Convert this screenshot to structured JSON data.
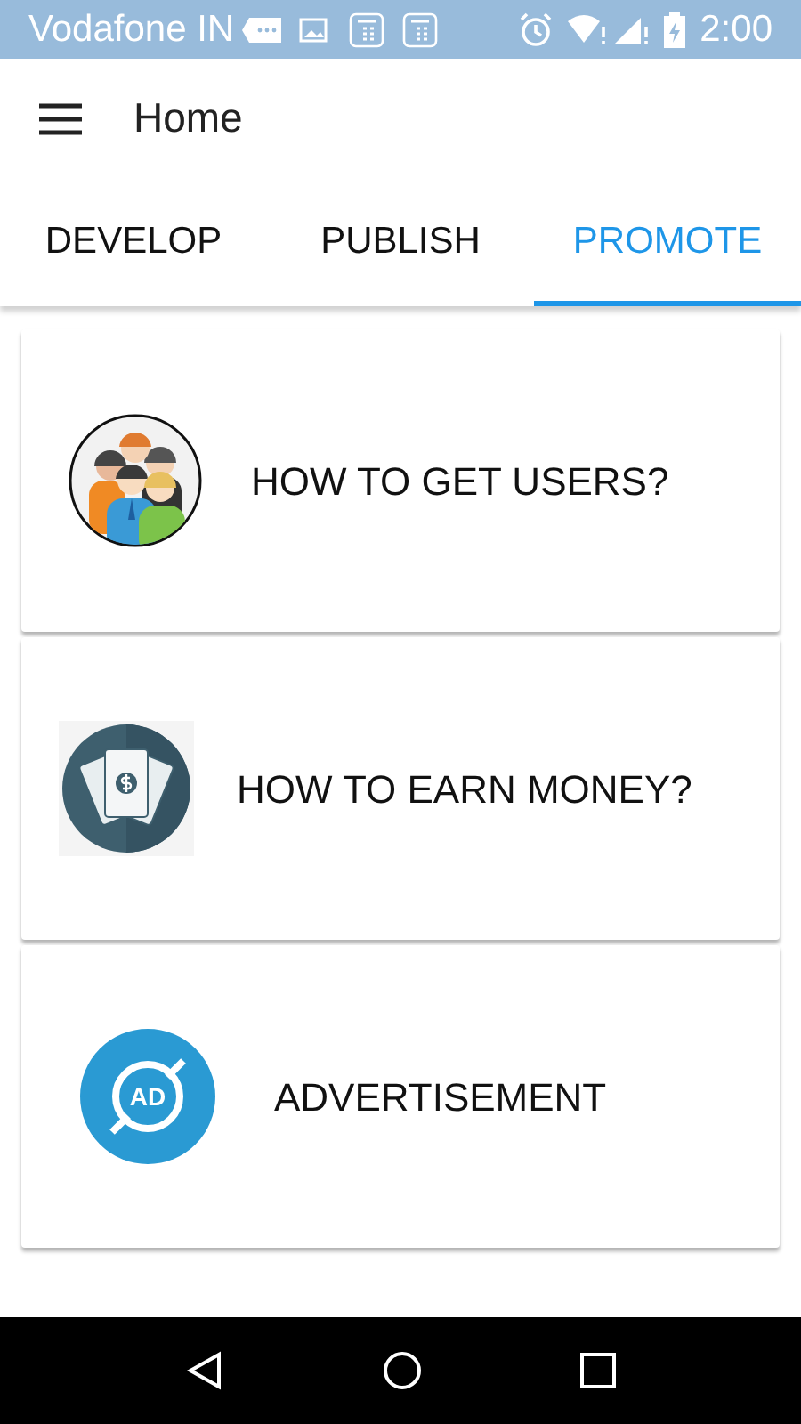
{
  "status_bar": {
    "carrier": "Vodafone IN",
    "time": "2:00"
  },
  "toolbar": {
    "title": "Home"
  },
  "tabs": [
    {
      "label": "DEVELOP",
      "selected": false
    },
    {
      "label": "PUBLISH",
      "selected": false
    },
    {
      "label": "PROMOTE",
      "selected": true
    }
  ],
  "cards": [
    {
      "kind": "users",
      "title": "HOW TO GET USERS?"
    },
    {
      "kind": "money",
      "title": "HOW TO EARN MONEY?"
    },
    {
      "kind": "ads",
      "title": "ADVERTISEMENT",
      "icon_text": "AD"
    }
  ]
}
